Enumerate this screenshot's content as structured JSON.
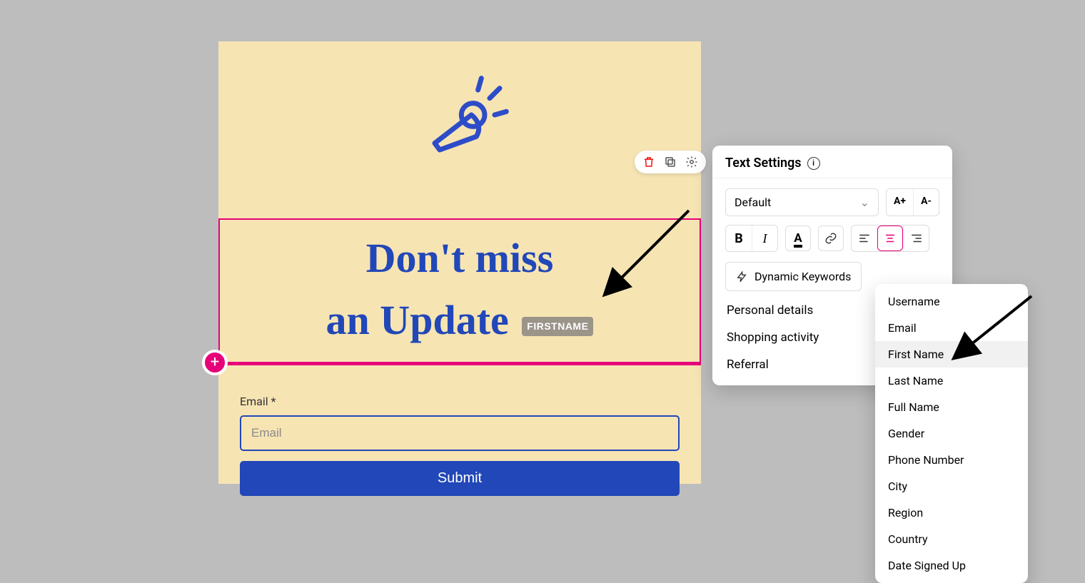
{
  "form": {
    "headline_line1": "Don't miss",
    "headline_line2": "an Update",
    "token": "FIRSTNAME",
    "email_label": "Email *",
    "email_placeholder": "Email",
    "submit_label": "Submit"
  },
  "settings": {
    "title": "Text Settings",
    "font_default": "Default",
    "size_up": "A+",
    "size_down": "A-",
    "dynamic_label": "Dynamic Keywords",
    "categories": [
      "Personal details",
      "Shopping activity",
      "Referral"
    ]
  },
  "submenu": {
    "items": [
      "Username",
      "Email",
      "First Name",
      "Last Name",
      "Full Name",
      "Gender",
      "Phone Number",
      "City",
      "Region",
      "Country",
      "Date Signed Up"
    ],
    "highlighted": "First Name"
  }
}
